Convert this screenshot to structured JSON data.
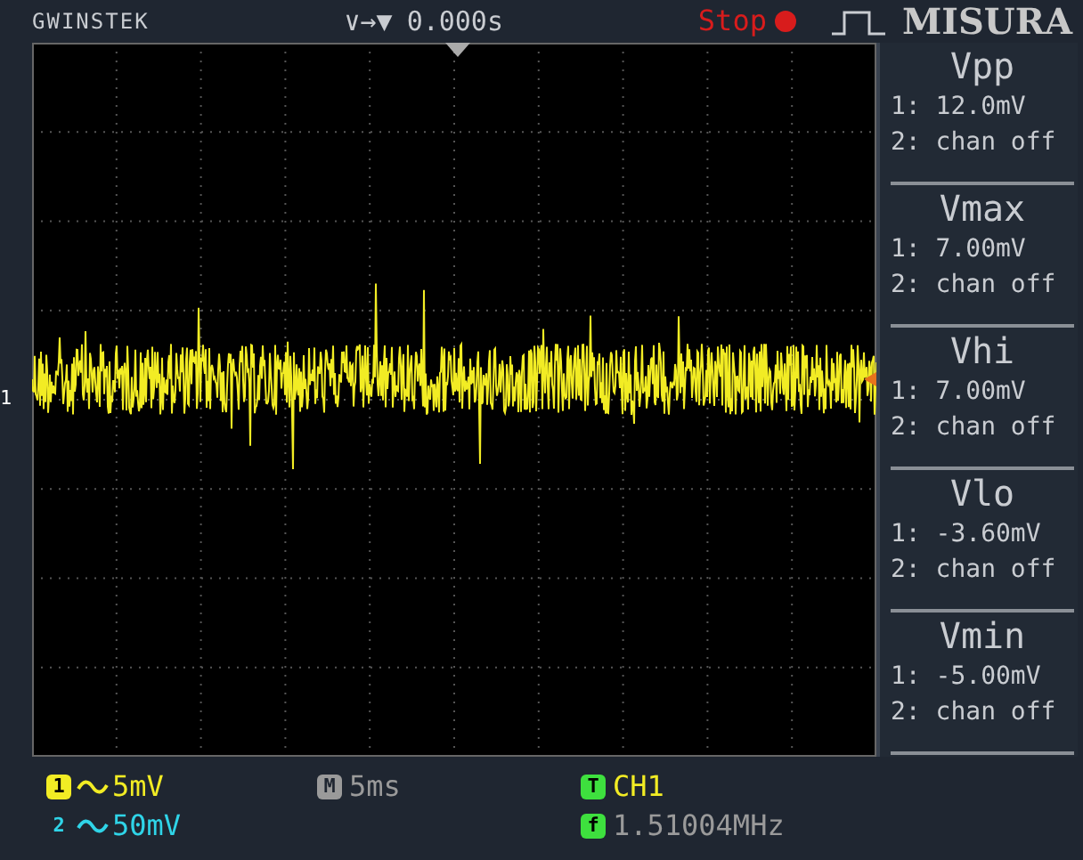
{
  "header": {
    "brand": "GWINSTEK",
    "horizontal_glyphs": "∨→▼",
    "time_offset": "0.000s",
    "run_state": "Stop",
    "label": "MISURA"
  },
  "channel_marker": "1",
  "measurements": [
    {
      "name": "Vpp",
      "ch1": "1: 12.0mV",
      "ch2": "2: chan off"
    },
    {
      "name": "Vmax",
      "ch1": "1: 7.00mV",
      "ch2": "2: chan off"
    },
    {
      "name": "Vhi",
      "ch1": "1: 7.00mV",
      "ch2": "2: chan off"
    },
    {
      "name": "Vlo",
      "ch1": "1: -3.60mV",
      "ch2": "2: chan off"
    },
    {
      "name": "Vmin",
      "ch1": "1: -5.00mV",
      "ch2": "2: chan off"
    }
  ],
  "status": {
    "ch1_badge": "1",
    "ch1_scale": "5mV",
    "ch2_badge": "2",
    "ch2_scale": "50mV",
    "timebase_badge": "M",
    "timebase": "5ms",
    "trigger_badge": "T",
    "trigger_source": "CH1",
    "frequency_badge": "f",
    "frequency": "1.51004MHz"
  }
}
